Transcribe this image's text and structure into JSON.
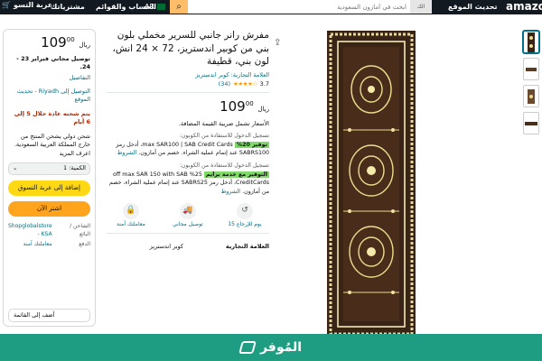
{
  "nav": {
    "cart": "عربة التسو",
    "orders": "مشترياتك",
    "account": "الحساب والقوائم",
    "lang": "AR",
    "search_placeholder": "ابحث في أمازون السعودية",
    "search_category": "الك",
    "deliver": "تحديث الموقع",
    "logo": "amazon"
  },
  "buybox": {
    "price_main": "109",
    "price_frac": "00",
    "currency": "ريال",
    "delivery_line": "توصيل مجاني فبراير 23 - 24.",
    "details_link": "التفاصيل",
    "location": "التوصيل إلى Riyadh - تحديث الموقع",
    "ships_in": "يتم شحنه عادة خلال 5 إلى 6 أيام",
    "intl": "شحن دولي  يشحن المنتج من خارج المملكة العربية السعودية. اعرف المزيد",
    "qty_label": "الكمية: 1",
    "add_to_cart": "إضافة إلى عربة التسوق",
    "buy_now": "اشتر الآن",
    "seller_key": "الشاحن / البائع",
    "seller_val": "Shopglobalstore - KSA",
    "payment_key": "الدفع",
    "payment_val": "معاملتك آمنة",
    "add_to_list": "أضف إلى القائمة"
  },
  "product": {
    "title": "مفرش رانر جانبي للسرير مخملي بلون بني من كوبير اندستريز، 72 × 24 انش، لون بني، قطيفة",
    "brand_link": "العلامة التجارية: كوبر اندستريز",
    "rating_value": "3.7",
    "rating_stars": "★★★★☆",
    "rating_count": "(34)",
    "price_main": "109",
    "price_frac": "00",
    "currency": "ريال",
    "vat": "الأسعار تشمل ضريبة القيمة المضافة.",
    "promo1_pre": "تسجيل الدخول للاستفادة من الكوبون:",
    "promo1_badge": "توفير 20%",
    "promo1_text": "max SAR100 | SAB Credit Cards، أدخل رمز SABRS100 عند إتمام عملية الشراء. خصم من أمازون.",
    "promo1_link": "الشروط",
    "promo2_pre": "تسجيل الدخول للاستفادة من الكوبون:",
    "promo2_badge": "التوفير مع خدمة برايم",
    "promo2_text": "25% off max SAR 150 with SAB CreditCards، أدخل رمز SABRS25 عند إتمام عملية الشراء، خصم من أمازون.",
    "promo2_link": "الشروط",
    "icons": [
      {
        "name": "return-icon",
        "glyph": "↺",
        "label": "15 يوم للإرجاع"
      },
      {
        "name": "free-delivery-icon",
        "glyph": "🚚",
        "label": "توصيل مجاني"
      },
      {
        "name": "secure-transaction-icon",
        "glyph": "🔒",
        "label": "معاملتك آمنة"
      }
    ],
    "spec_key": "العلامة التجارية",
    "spec_val": "كوبر اندستريز"
  },
  "banner": {
    "text": "المُوفر"
  },
  "colors": {
    "nav_bg": "#131921",
    "accent_orange": "#ff9900",
    "cart_button": "#ffd814",
    "buy_button": "#ffa41c",
    "banner_bg": "#1f9d83",
    "link": "#007185",
    "deal_red": "#b12704"
  }
}
